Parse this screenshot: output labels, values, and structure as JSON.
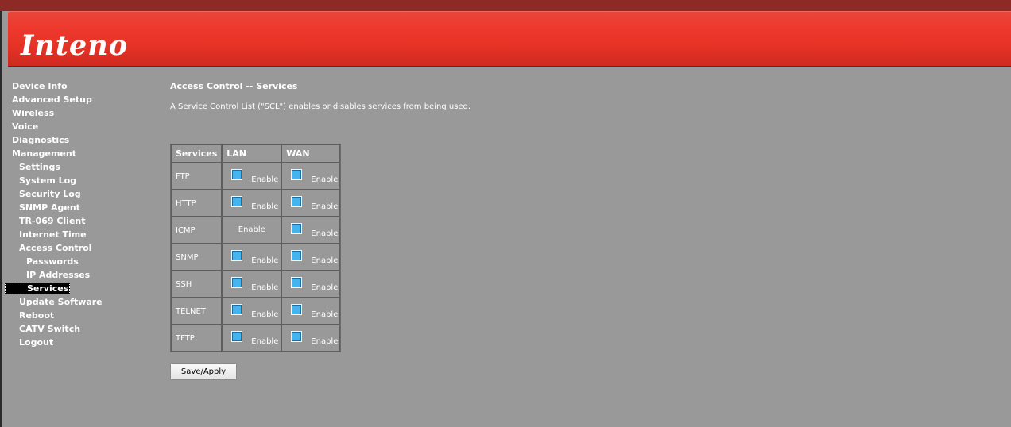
{
  "brand": {
    "logo_text": "Inteno"
  },
  "nav": {
    "device_info": "Device Info",
    "advanced_setup": "Advanced Setup",
    "wireless": "Wireless",
    "voice": "Voice",
    "diagnostics": "Diagnostics",
    "management": "Management",
    "settings": "Settings",
    "system_log": "System Log",
    "security_log": "Security Log",
    "snmp_agent": "SNMP Agent",
    "tr069_client": "TR-069 Client",
    "internet_time": "Internet Time",
    "access_control": "Access Control",
    "passwords": "Passwords",
    "ip_addresses": "IP Addresses",
    "services": "Services",
    "update_software": "Update Software",
    "reboot": "Reboot",
    "catv_switch": "CATV Switch",
    "logout": "Logout",
    "active": "Services"
  },
  "main": {
    "title": "Access Control -- Services",
    "description": "A Service Control List (\"SCL\") enables or disables services from being used."
  },
  "table": {
    "headers": {
      "services": "Services",
      "lan": "LAN",
      "wan": "WAN"
    },
    "rows": [
      {
        "service": "FTP",
        "lan": "Enable",
        "wan": "Enable",
        "lan_checked": false,
        "wan_checked": false
      },
      {
        "service": "HTTP",
        "lan": "Enable",
        "wan": "Enable",
        "lan_checked": false,
        "wan_checked": false
      },
      {
        "service": "ICMP",
        "lan": "Enable",
        "wan": "Enable",
        "lan_checked": false,
        "wan_checked": false
      },
      {
        "service": "SNMP",
        "lan": "Enable",
        "wan": "Enable",
        "lan_checked": false,
        "wan_checked": false
      },
      {
        "service": "SSH",
        "lan": "Enable",
        "wan": "Enable",
        "lan_checked": false,
        "wan_checked": false
      },
      {
        "service": "TELNET",
        "lan": "Enable",
        "wan": "Enable",
        "lan_checked": false,
        "wan_checked": false
      },
      {
        "service": "TFTP",
        "lan": "Enable",
        "wan": "Enable",
        "lan_checked": false,
        "wan_checked": false
      }
    ]
  },
  "actions": {
    "save_apply": "Save/Apply"
  },
  "colors": {
    "banner_red": "#e83327",
    "page_gray": "#999999",
    "checkbox_blue": "#44b4ee"
  }
}
